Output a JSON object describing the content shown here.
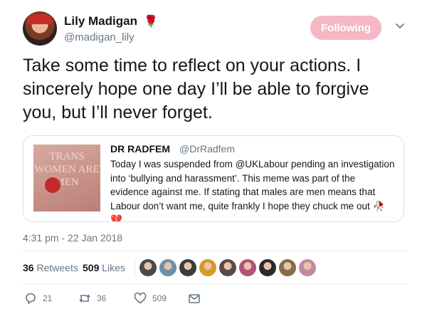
{
  "author": {
    "name": "Lily Madigan",
    "emoji": "🌹",
    "handle": "@madigan_lily"
  },
  "follow_button": {
    "label": "Following"
  },
  "tweet": {
    "text": "Take some time to reflect on your actions. I sincerely hope one day I’ll be able to forgive you, but I’ll never forget."
  },
  "quoted": {
    "name": "DR RADFEM",
    "handle": "@DrRadfem",
    "text": "Today I was suspended from @UKLabour pending an investigation into ‘bullying and harassment’. This meme was part of the evidence against me. If stating that males are men means that Labour don’t want me, quite frankly I hope they chuck me out 🥀💔",
    "image_text": "TRANS WOMEN ARE MEN"
  },
  "timestamp": "4:31 pm - 22 Jan 2018",
  "stats": {
    "retweets_count": "36",
    "retweets_label": "Retweets",
    "likes_count": "509",
    "likes_label": "Likes"
  },
  "likers": [
    "#4a4a4a",
    "#6d8fa8",
    "#3b3b3b",
    "#d19a2a",
    "#5a4a4a",
    "#b0527a",
    "#2a2a2a",
    "#8a6a4a",
    "#c08aa0"
  ],
  "actions": {
    "reply_count": "21",
    "retweet_count": "36",
    "like_count": "509"
  },
  "colors": {
    "follow_bg": "#f7b7c4",
    "secondary_text": "#657786",
    "primary_text": "#14171a",
    "border": "#e6ecf0"
  }
}
